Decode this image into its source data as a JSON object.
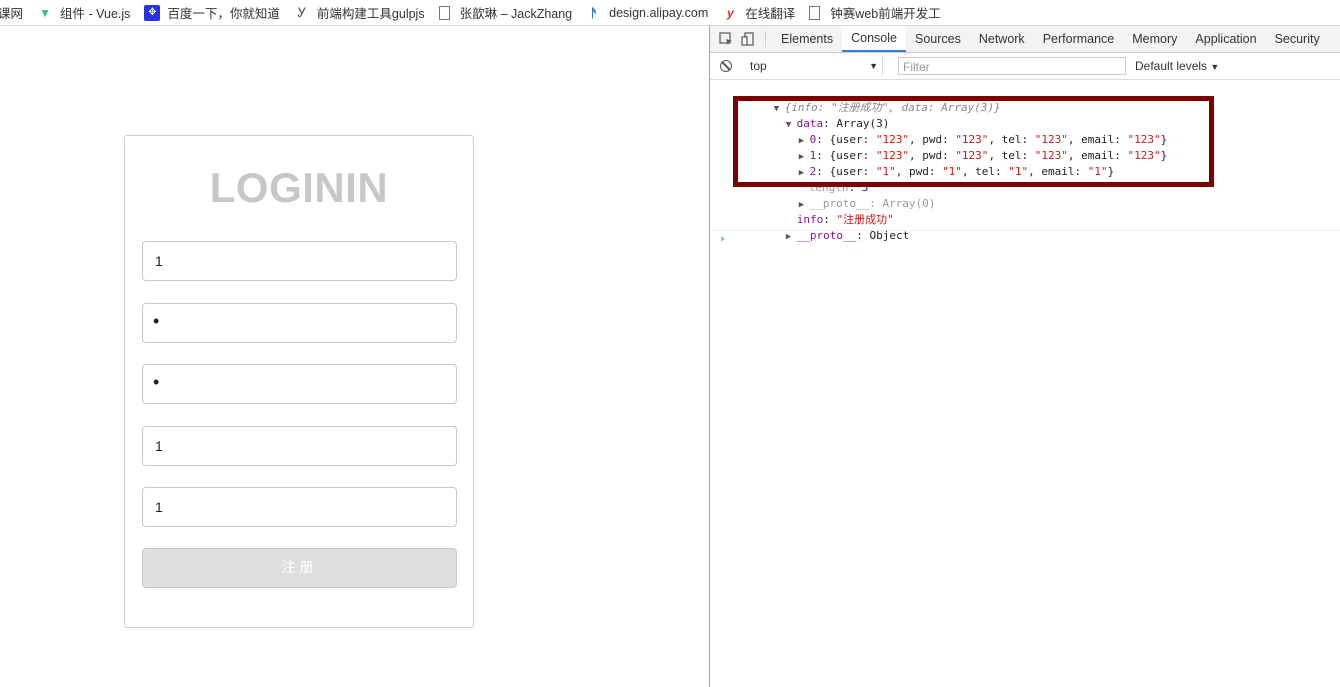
{
  "bookmarks": [
    {
      "icon": "page-icon",
      "label": "课网"
    },
    {
      "icon": "vue-icon",
      "label": "组件 - Vue.js"
    },
    {
      "icon": "baidu-icon",
      "label": "百度一下，你就知道"
    },
    {
      "icon": "gulp-icon",
      "label": "前端构建工具gulpjs"
    },
    {
      "icon": "page-icon",
      "label": "张歆琳 – JackZhang"
    },
    {
      "icon": "alipay-icon",
      "label": "design.alipay.com"
    },
    {
      "icon": "youdao-icon",
      "label": "在线翻译"
    },
    {
      "icon": "page-icon",
      "label": "钟赛web前端开发工"
    }
  ],
  "form": {
    "title": "LOGININ",
    "fields": {
      "user": "1",
      "pwd": "•",
      "pwd2": "•",
      "tel": "1",
      "email": "1"
    },
    "submit_label": "注册"
  },
  "devtools": {
    "tabs": [
      "Elements",
      "Console",
      "Sources",
      "Network",
      "Performance",
      "Memory",
      "Application",
      "Security"
    ],
    "active_tab": "Console",
    "context": "top",
    "filter_placeholder": "Filter",
    "levels": "Default levels",
    "console": {
      "summary": "{info: \"注册成功\", data: Array(3)}",
      "data_key": "data",
      "data_val": "Array(3)",
      "rows": [
        {
          "idx": "0",
          "user": "\"123\"",
          "pwd": "\"123\"",
          "tel": "\"123\"",
          "email": "\"123\""
        },
        {
          "idx": "1",
          "user": "\"123\"",
          "pwd": "\"123\"",
          "tel": "\"123\"",
          "email": "\"123\""
        },
        {
          "idx": "2",
          "user": "\"1\"",
          "pwd": "\"1\"",
          "tel": "\"1\"",
          "email": "\"1\""
        }
      ],
      "length_key": "length",
      "length_val": "3",
      "proto_arr": "__proto__: Array(0)",
      "info_key": "info",
      "info_val": "\"注册成功\"",
      "proto_obj_key": "__proto__",
      "proto_obj_val": "Object"
    }
  }
}
